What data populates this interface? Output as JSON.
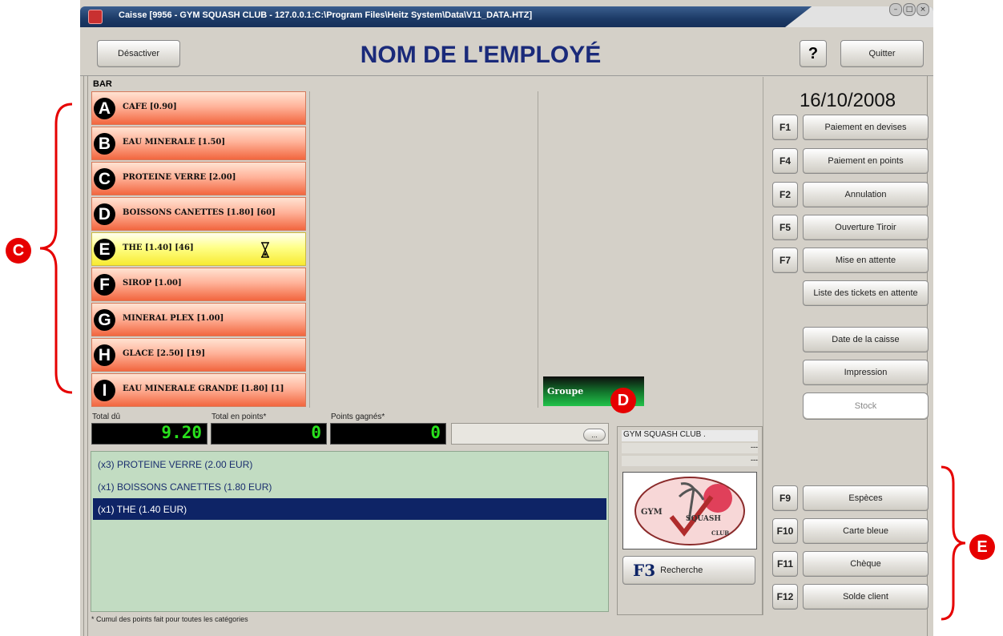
{
  "window": {
    "title": "Caisse [9956 - GYM SQUASH CLUB - 127.0.0.1:C:\\Program Files\\Heitz System\\Data\\V11_DATA.HTZ]",
    "controls": [
      "minimize",
      "maximize",
      "close"
    ]
  },
  "header": {
    "deactivate_label": "Désactiver",
    "title": "NOM DE L'EMPLOYÉ",
    "help_label": "?",
    "quit_label": "Quitter"
  },
  "category": "BAR",
  "products": [
    {
      "letter": "A",
      "label": "CAFE [0.90]",
      "selected": false
    },
    {
      "letter": "B",
      "label": "EAU MINERALE [1.50]",
      "selected": false
    },
    {
      "letter": "C",
      "label": "PROTEINE VERRE [2.00]",
      "selected": false
    },
    {
      "letter": "D",
      "label": "BOISSONS CANETTES [1.80] [60]",
      "selected": false
    },
    {
      "letter": "E",
      "label": "THE [1.40] [46]",
      "selected": true
    },
    {
      "letter": "F",
      "label": "SIROP [1.00]",
      "selected": false
    },
    {
      "letter": "G",
      "label": "MINERAL PLEX [1.00]",
      "selected": false
    },
    {
      "letter": "H",
      "label": "GLACE [2.50] [19]",
      "selected": false
    },
    {
      "letter": "I",
      "label": "EAU MINERALE GRANDE [1.80] [1]",
      "selected": false
    }
  ],
  "group_button": "Groupe",
  "totals": {
    "total_due_label": "Total dû",
    "total_due_value": "9.20",
    "points_total_label": "Total en points*",
    "points_total_value": "0",
    "points_earned_label": "Points gagnés*",
    "points_earned_value": "0",
    "more_button": "..."
  },
  "ticket_lines": [
    "(x3) PROTEINE VERRE (2.00 EUR)",
    "(x1) BOISSONS CANETTES (1.80 EUR)",
    "(x1) THE (1.40 EUR)"
  ],
  "footnote": "* Cumul des points fait pour toutes les catégories",
  "club": {
    "name": "GYM SQUASH CLUB .",
    "line2": "---",
    "line3": "---",
    "logo_text": [
      "GYM",
      "SQUASH",
      "CLUB"
    ],
    "search_key": "F3",
    "search_label": "Recherche"
  },
  "date": "16/10/2008",
  "right_buttons": [
    {
      "key": "F1",
      "label": "Paiement en devises"
    },
    {
      "key": "F4",
      "label": "Paiement en points"
    },
    {
      "key": "F2",
      "label": "Annulation"
    },
    {
      "key": "F5",
      "label": "Ouverture Tiroir"
    },
    {
      "key": "F7",
      "label": "Mise en attente"
    },
    {
      "key": "",
      "label": "Liste des tickets en attente"
    },
    {
      "key": "",
      "label": "Date de la caisse"
    },
    {
      "key": "",
      "label": "Impression"
    },
    {
      "key": "",
      "label": "Stock"
    }
  ],
  "payment_buttons": [
    {
      "key": "F9",
      "label": "Espèces"
    },
    {
      "key": "F10",
      "label": "Carte bleue"
    },
    {
      "key": "F11",
      "label": "Chèque"
    },
    {
      "key": "F12",
      "label": "Solde client"
    }
  ],
  "annotations": {
    "c": "C",
    "d": "D",
    "e": "E"
  },
  "colors": {
    "title_blue": "#1a2a7a",
    "lcd_green": "#28e01c",
    "product_red": "#f2663f",
    "product_selected": "#f7ea32",
    "ticket_bg": "#c2dcc2",
    "selection": "#0e2466",
    "annotation_red": "#e60000"
  }
}
